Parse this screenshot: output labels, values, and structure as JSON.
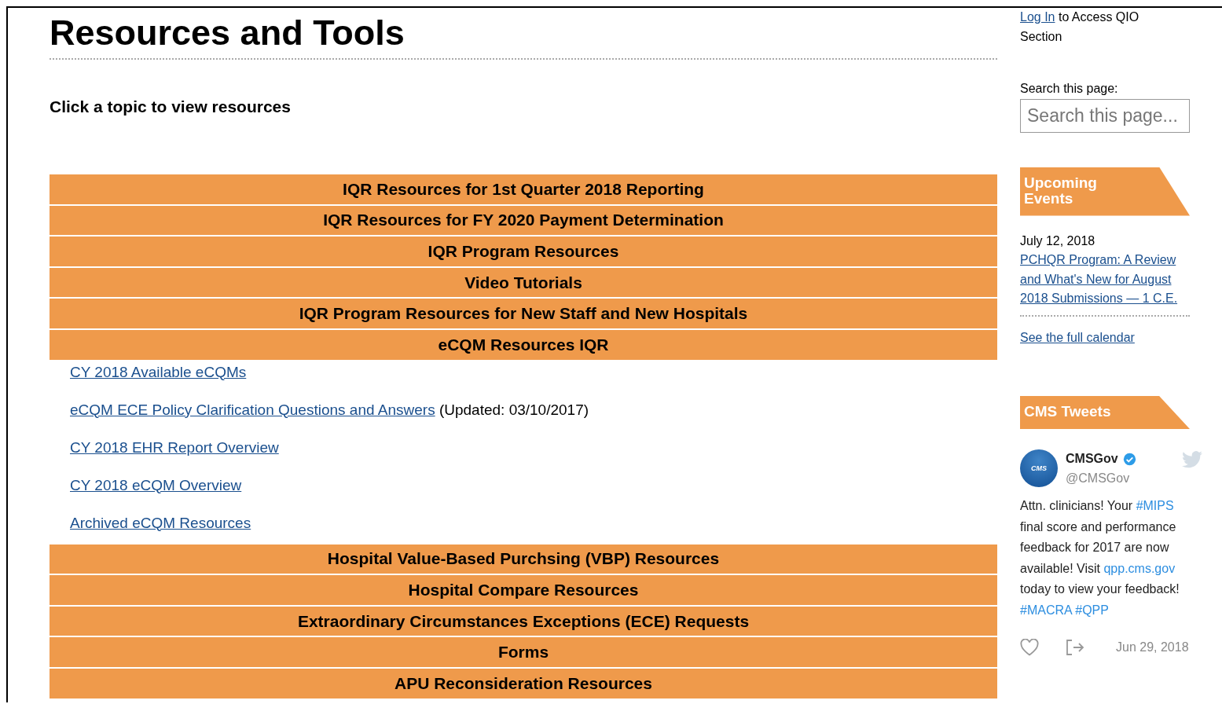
{
  "title": "Resources and Tools",
  "intro": "Click a topic to view resources",
  "topics": [
    {
      "label": "IQR Resources for 1st Quarter 2018 Reporting"
    },
    {
      "label": "IQR Resources for FY 2020 Payment Determination"
    },
    {
      "label": "IQR Program Resources"
    },
    {
      "label": "Video Tutorials"
    },
    {
      "label": "IQR Program Resources for New Staff and New Hospitals"
    },
    {
      "label": "eCQM Resources IQR",
      "children": [
        {
          "link": "CY 2018 Available eCQMs"
        },
        {
          "link": "eCQM ECE Policy Clarification Questions and Answers",
          "note": "(Updated: 03/10/2017)"
        },
        {
          "link": "CY 2018 EHR Report Overview"
        },
        {
          "link": "CY 2018 eCQM Overview"
        },
        {
          "link": "Archived eCQM Resources"
        }
      ]
    },
    {
      "label": "Hospital Value-Based Purchsing (VBP) Resources"
    },
    {
      "label": "Hospital Compare Resources"
    },
    {
      "label": "Extraordinary Circumstances Exceptions (ECE) Requests"
    },
    {
      "label": "Forms"
    },
    {
      "label": "APU Reconsideration Resources"
    }
  ],
  "sidebar": {
    "login": {
      "link": "Log In",
      "text": "to Access QIO Section"
    },
    "search": {
      "label": "Search this page:",
      "placeholder": "Search this page..."
    },
    "events": {
      "heading": "Upcoming Events",
      "items": [
        {
          "date": "July 12, 2018",
          "link": "PCHQR Program: A Review and What's New for August 2018 Submissions — 1 C.E."
        }
      ],
      "calendar_link": "See the full calendar"
    },
    "tweets": {
      "heading": "CMS Tweets",
      "name": "CMSGov",
      "verified": true,
      "handle": "@CMSGov",
      "avatar": "CMS",
      "body": [
        {
          "kind": "text",
          "text": "Attn. clinicians! Your "
        },
        {
          "kind": "link",
          "text": "#MIPS"
        },
        {
          "kind": "text",
          "text": " final score and performance feedback for 2017 are now available! Visit "
        },
        {
          "kind": "link",
          "text": "qpp.cms.gov"
        },
        {
          "kind": "text",
          "text": " today to view your feedback! "
        },
        {
          "kind": "link",
          "text": "#MACRA"
        },
        {
          "kind": "link",
          "text": "#QPP"
        }
      ],
      "date": "Jun 29, 2018"
    }
  }
}
